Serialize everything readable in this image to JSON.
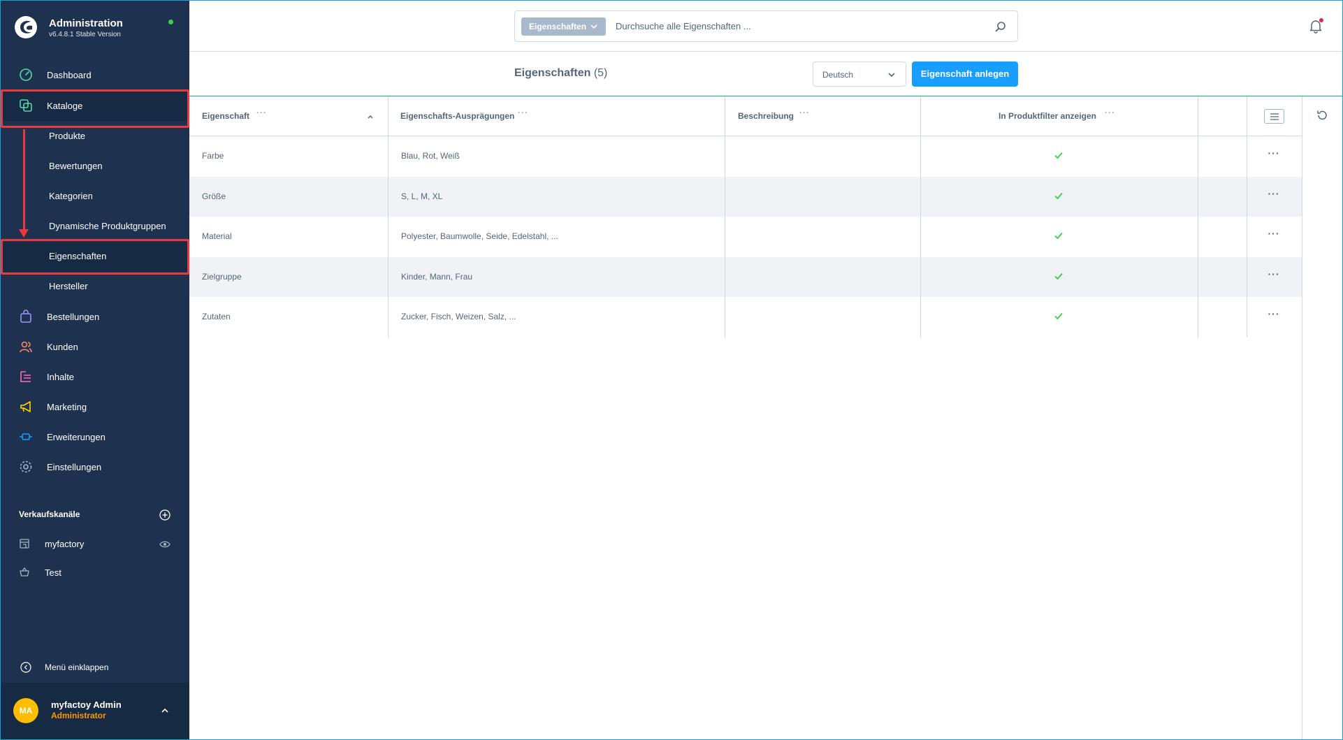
{
  "brand": {
    "title": "Administration",
    "version": "v6.4.8.1 Stable Version"
  },
  "nav": {
    "dashboard": "Dashboard",
    "kataloge": "Kataloge",
    "sub": [
      "Produkte",
      "Bewertungen",
      "Kategorien",
      "Dynamische Produktgruppen",
      "Eigenschaften",
      "Hersteller"
    ],
    "bestellungen": "Bestellungen",
    "kunden": "Kunden",
    "inhalte": "Inhalte",
    "marketing": "Marketing",
    "erweiterungen": "Erweiterungen",
    "einstellungen": "Einstellungen"
  },
  "sales_channels": {
    "title": "Verkaufskanäle",
    "items": [
      "myfactory",
      "Test"
    ]
  },
  "collapse_label": "Menü einklappen",
  "user": {
    "initials": "MA",
    "name": "myfactoy Admin",
    "role": "Administrator"
  },
  "search": {
    "type": "Eigenschaften",
    "placeholder": "Durchsuche alle Eigenschaften ..."
  },
  "page": {
    "title": "Eigenschaften",
    "count": "(5)"
  },
  "language": "Deutsch",
  "create_button": "Eigenschaft anlegen",
  "grid": {
    "columns": [
      "Eigenschaft",
      "Eigenschafts-Ausprägungen",
      "Beschreibung",
      "In Produktfilter anzeigen"
    ],
    "rows": [
      {
        "name": "Farbe",
        "options": "Blau, Rot, Weiß",
        "description": "",
        "filterable": true
      },
      {
        "name": "Größe",
        "options": "S, L, M, XL",
        "description": "",
        "filterable": true
      },
      {
        "name": "Material",
        "options": "Polyester, Baumwolle, Seide, Edelstahl, ...",
        "description": "",
        "filterable": true
      },
      {
        "name": "Zielgruppe",
        "options": "Kinder, Mann, Frau",
        "description": "",
        "filterable": true
      },
      {
        "name": "Zutaten",
        "options": "Zucker, Fisch, Weizen, Salz, ...",
        "description": "",
        "filterable": true
      }
    ]
  },
  "colors": {
    "sidebar": "#1e3250",
    "primary": "#189eff",
    "highlight": "#e9393c",
    "check": "#37d046",
    "avatar": "#ffbd00",
    "role": "#ff9800"
  }
}
